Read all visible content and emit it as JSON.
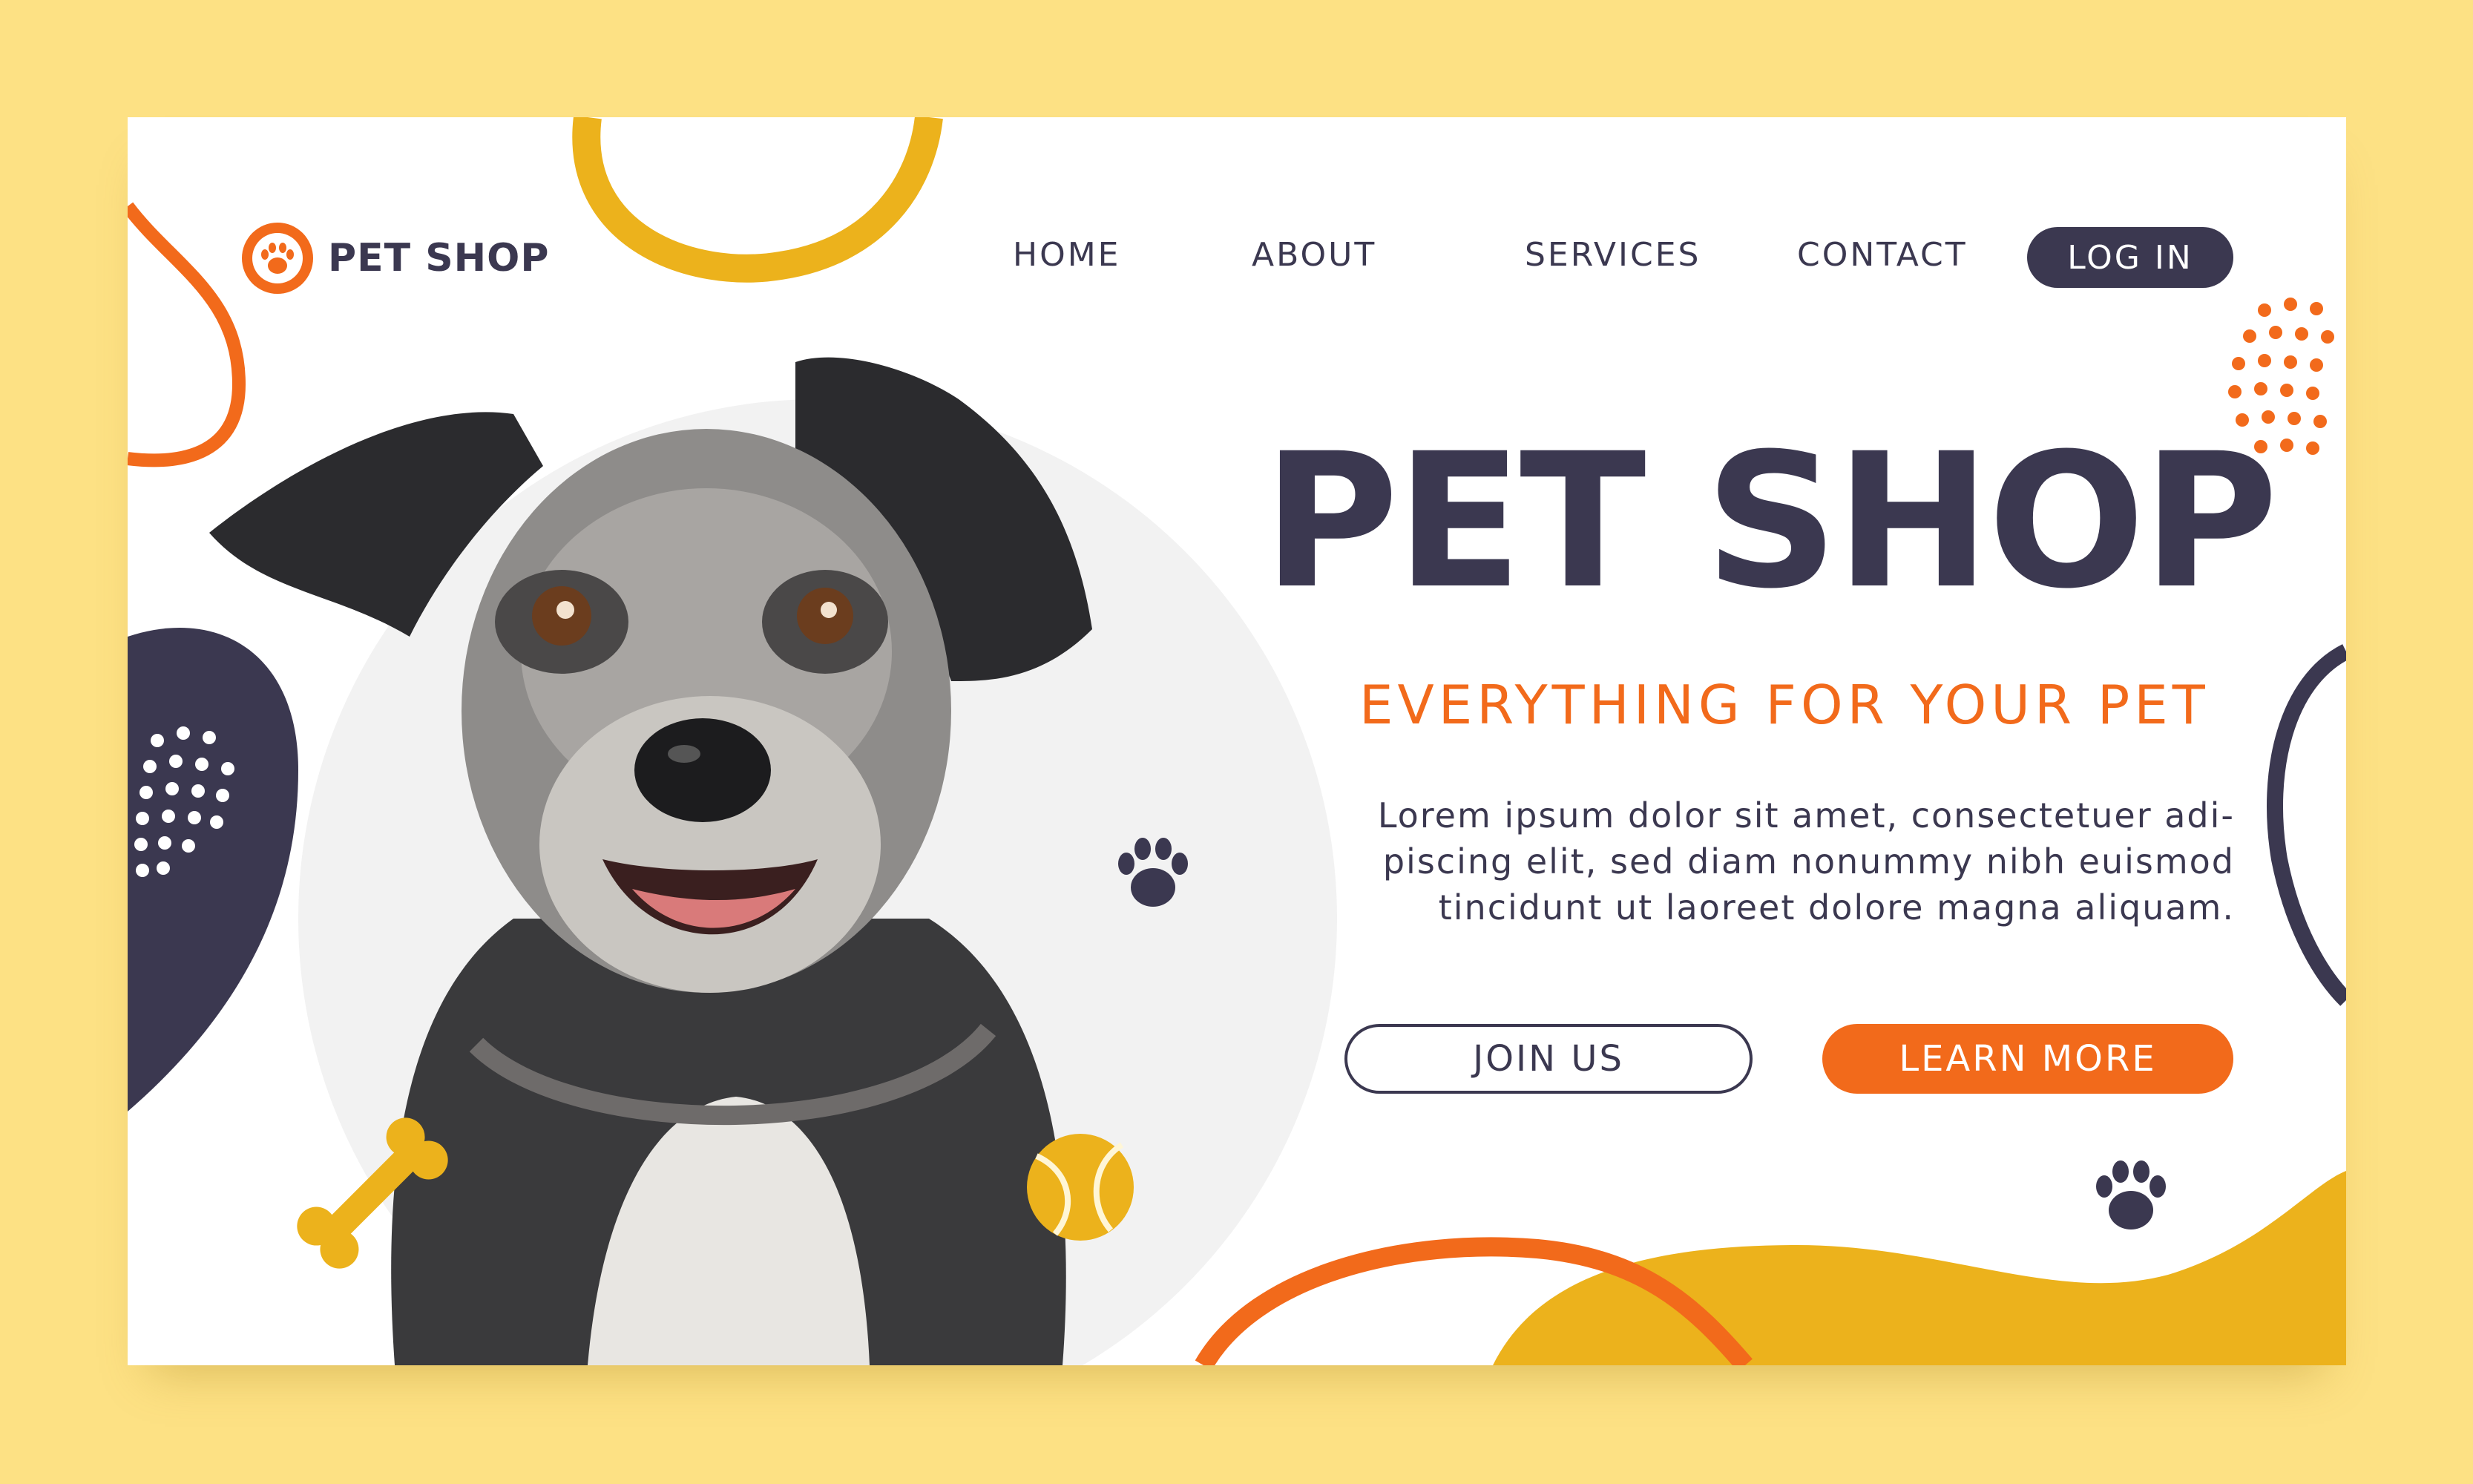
{
  "brand": {
    "name": "PET SHOP",
    "logo_icon": "paw-icon"
  },
  "nav": {
    "items": [
      {
        "label": "HOME"
      },
      {
        "label": "ABOUT"
      },
      {
        "label": "SERVICES"
      },
      {
        "label": "CONTACT"
      }
    ],
    "login_label": "LOG IN"
  },
  "hero": {
    "title": "PET SHOP",
    "subtitle": "EVERYTHING FOR YOUR PET",
    "description_lines": [
      "Lorem ipsum dolor sit amet, consectetuer adi-",
      "piscing elit, sed diam nonummy nibh euismod",
      "tincidunt ut laoreet dolore magna aliquam."
    ],
    "join_label": "JOIN US",
    "learn_label": "LEARN MORE",
    "image": "dog-photo"
  },
  "decorations": [
    "bone-icon",
    "tennis-ball-icon",
    "paw-print-icon"
  ],
  "colors": {
    "page_background": "#fde184",
    "navy": "#3b3850",
    "orange": "#f26a1b",
    "yellow": "#ecb21c",
    "white": "#ffffff"
  }
}
